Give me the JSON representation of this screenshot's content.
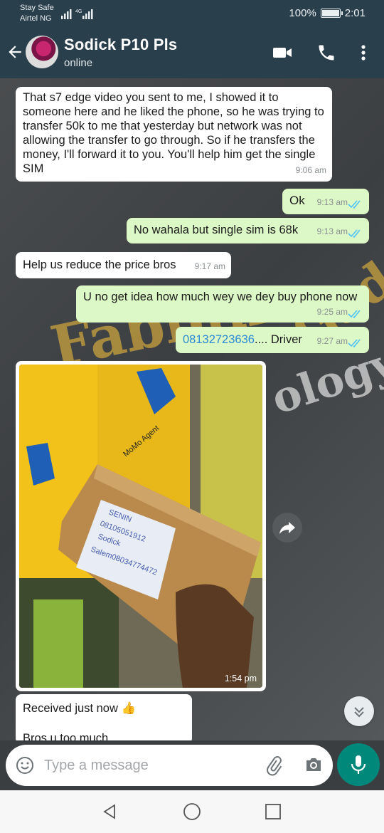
{
  "status_bar": {
    "carrier_line1": "Stay Safe",
    "carrier_line2": "Airtel NG",
    "network_type": "4G",
    "battery": "100%",
    "time": "2:01"
  },
  "header": {
    "contact_name": "Sodick P10 Pls",
    "contact_status": "online",
    "icons": [
      "back-arrow-icon",
      "video-call-icon",
      "phone-icon",
      "more-vert-icon"
    ]
  },
  "watermark": {
    "word1": "Fabbin",
    "word2": "Gadgets",
    "word3": "ology"
  },
  "messages": [
    {
      "dir": "in",
      "text": "That s7 edge video you sent to me, I showed it to someone here and he liked the phone, so he was trying to transfer 50k to me that yesterday but network was not allowing the transfer to go through. So if he transfers the money, I'll forward it to you. You'll help him get the single SIM",
      "time": "9:06 am"
    },
    {
      "dir": "out",
      "text": "Ok",
      "time": "9:13 am"
    },
    {
      "dir": "out",
      "text": "No wahala but single sim is 68k",
      "time": "9:13 am"
    },
    {
      "dir": "in",
      "text": "Help us reduce the price bros",
      "time": "9:17 am"
    },
    {
      "dir": "out",
      "text": "U no get idea how much wey we dey buy phone now",
      "time": "9:25 am"
    },
    {
      "dir": "out",
      "phone": "08132723636",
      "text": ".... Driver",
      "time": "9:27 am"
    },
    {
      "dir": "in",
      "text": "Received just now 👍",
      "time": ""
    },
    {
      "dir": "in",
      "text": "Bros u too much",
      "time": ""
    }
  ],
  "image_message": {
    "time": "1:54 pm",
    "label_text": [
      "SENIN",
      "08105051912",
      "Sodick",
      "Salem08034774472"
    ],
    "sign_text": "MoMo Agent"
  },
  "input": {
    "placeholder": "Type a message",
    "icons": [
      "emoji-icon",
      "attach-icon",
      "camera-icon",
      "mic-icon"
    ]
  },
  "colors": {
    "header": "#2a3f4c",
    "outgoing_bubble": "#dcf8c6",
    "incoming_bubble": "#ffffff",
    "read_tick": "#4fc3f7",
    "mic_button": "#00897b"
  }
}
